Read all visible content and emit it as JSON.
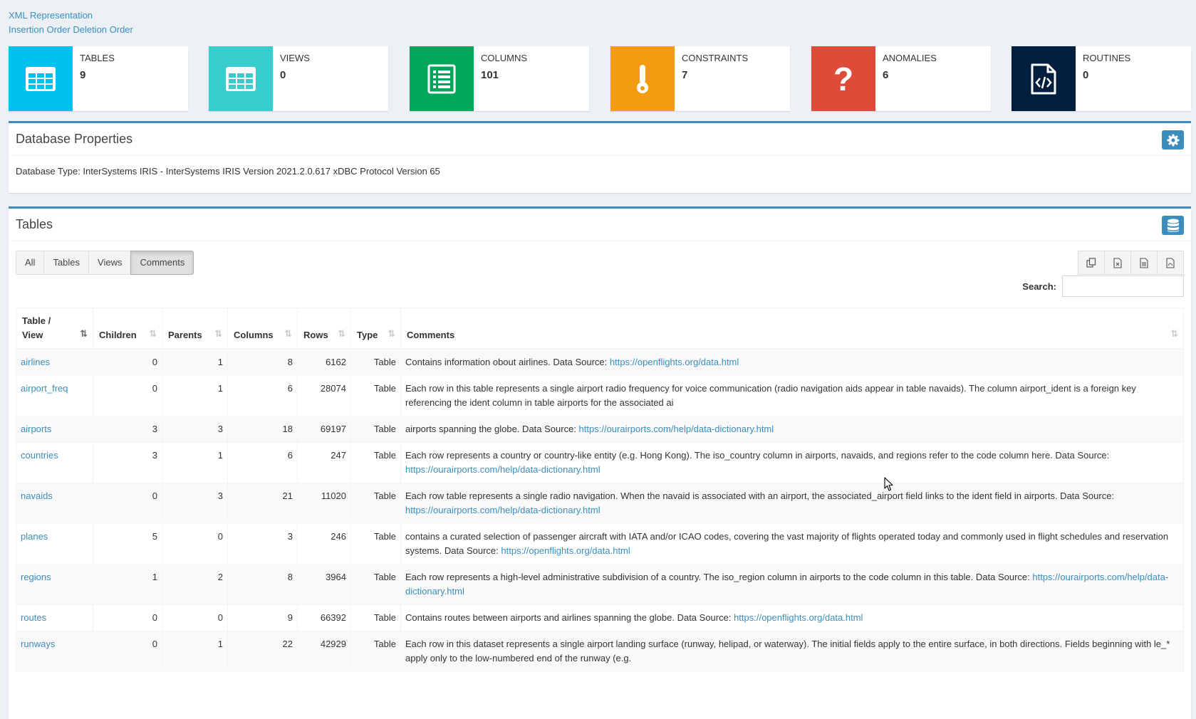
{
  "links": {
    "xml": "XML Representation",
    "insertion_order": "Insertion Order",
    "deletion_order": "Deletion Order"
  },
  "stats": [
    {
      "label": "TABLES",
      "value": "9",
      "color": "#00c0ef",
      "icon": "table-icon"
    },
    {
      "label": "VIEWS",
      "value": "0",
      "color": "#39cccc",
      "icon": "table-icon"
    },
    {
      "label": "COLUMNS",
      "value": "101",
      "color": "#00a65a",
      "icon": "list-icon"
    },
    {
      "label": "CONSTRAINTS",
      "value": "7",
      "color": "#f39c12",
      "icon": "key-icon"
    },
    {
      "label": "ANOMALIES",
      "value": "6",
      "color": "#dd4b39",
      "icon": "question-icon"
    },
    {
      "label": "ROUTINES",
      "value": "0",
      "color": "#001f3f",
      "icon": "code-file-icon"
    }
  ],
  "db_properties": {
    "title": "Database Properties",
    "db_type": "Database Type: InterSystems IRIS - InterSystems IRIS Version 2021.2.0.617 xDBC Protocol Version 65"
  },
  "tables_box": {
    "title": "Tables",
    "filters": [
      "All",
      "Tables",
      "Views",
      "Comments"
    ],
    "active_filter": "Comments",
    "search_label": "Search:",
    "search_value": "",
    "columns": [
      "Table / View",
      "Children",
      "Parents",
      "Columns",
      "Rows",
      "Type",
      "Comments"
    ],
    "rows": [
      {
        "name": "airlines",
        "children": "0",
        "parents": "1",
        "columns": "8",
        "rows": "6162",
        "type": "Table",
        "comment": "Contains information obout airlines. Data Source: ",
        "link": "https://openflights.org/data.html"
      },
      {
        "name": "airport_freq",
        "children": "0",
        "parents": "1",
        "columns": "6",
        "rows": "28074",
        "type": "Table",
        "comment": "Each row in this table represents a single airport radio frequency for voice communication (radio navigation aids appear in table navaids). The column airport_ident is a foreign key referencing the ident column in table airports for the associated ai",
        "link": ""
      },
      {
        "name": "airports",
        "children": "3",
        "parents": "3",
        "columns": "18",
        "rows": "69197",
        "type": "Table",
        "comment": "airports spanning the globe. Data Source: ",
        "link": "https://ourairports.com/help/data-dictionary.html"
      },
      {
        "name": "countries",
        "children": "3",
        "parents": "1",
        "columns": "6",
        "rows": "247",
        "type": "Table",
        "comment": "Each row represents a country or country-like entity (e.g. Hong Kong). The iso_country column in airports, navaids, and regions refer to the code column here. Data Source: ",
        "link": "https://ourairports.com/help/data-dictionary.html"
      },
      {
        "name": "navaids",
        "children": "0",
        "parents": "3",
        "columns": "21",
        "rows": "11020",
        "type": "Table",
        "comment": "Each row table represents a single radio navigation. When the navaid is associated with an airport, the associated_airport field links to the ident field in airports. Data Source: ",
        "link": "https://ourairports.com/help/data-dictionary.html"
      },
      {
        "name": "planes",
        "children": "5",
        "parents": "0",
        "columns": "3",
        "rows": "246",
        "type": "Table",
        "comment": "contains a curated selection of passenger aircraft with IATA and/or ICAO codes, covering the vast majority of flights operated today and commonly used in flight schedules and reservation systems. Data Source: ",
        "link": "https://openflights.org/data.html"
      },
      {
        "name": "regions",
        "children": "1",
        "parents": "2",
        "columns": "8",
        "rows": "3964",
        "type": "Table",
        "comment": "Each row represents a high-level administrative subdivision of a country. The iso_region column in airports to the code column in this table. Data Source: ",
        "link": "https://ourairports.com/help/data-dictionary.html"
      },
      {
        "name": "routes",
        "children": "0",
        "parents": "0",
        "columns": "9",
        "rows": "66392",
        "type": "Table",
        "comment": "Contains routes between airports and airlines spanning the globe. Data Source: ",
        "link": "https://openflights.org/data.html"
      },
      {
        "name": "runways",
        "children": "0",
        "parents": "1",
        "columns": "22",
        "rows": "42929",
        "type": "Table",
        "comment": "Each row in this dataset represents a single airport landing surface (runway, helipad, or waterway). The initial fields apply to the entire surface, in both directions. Fields beginning with le_* apply only to the low-numbered end of the runway (e.g.",
        "link": ""
      }
    ]
  }
}
